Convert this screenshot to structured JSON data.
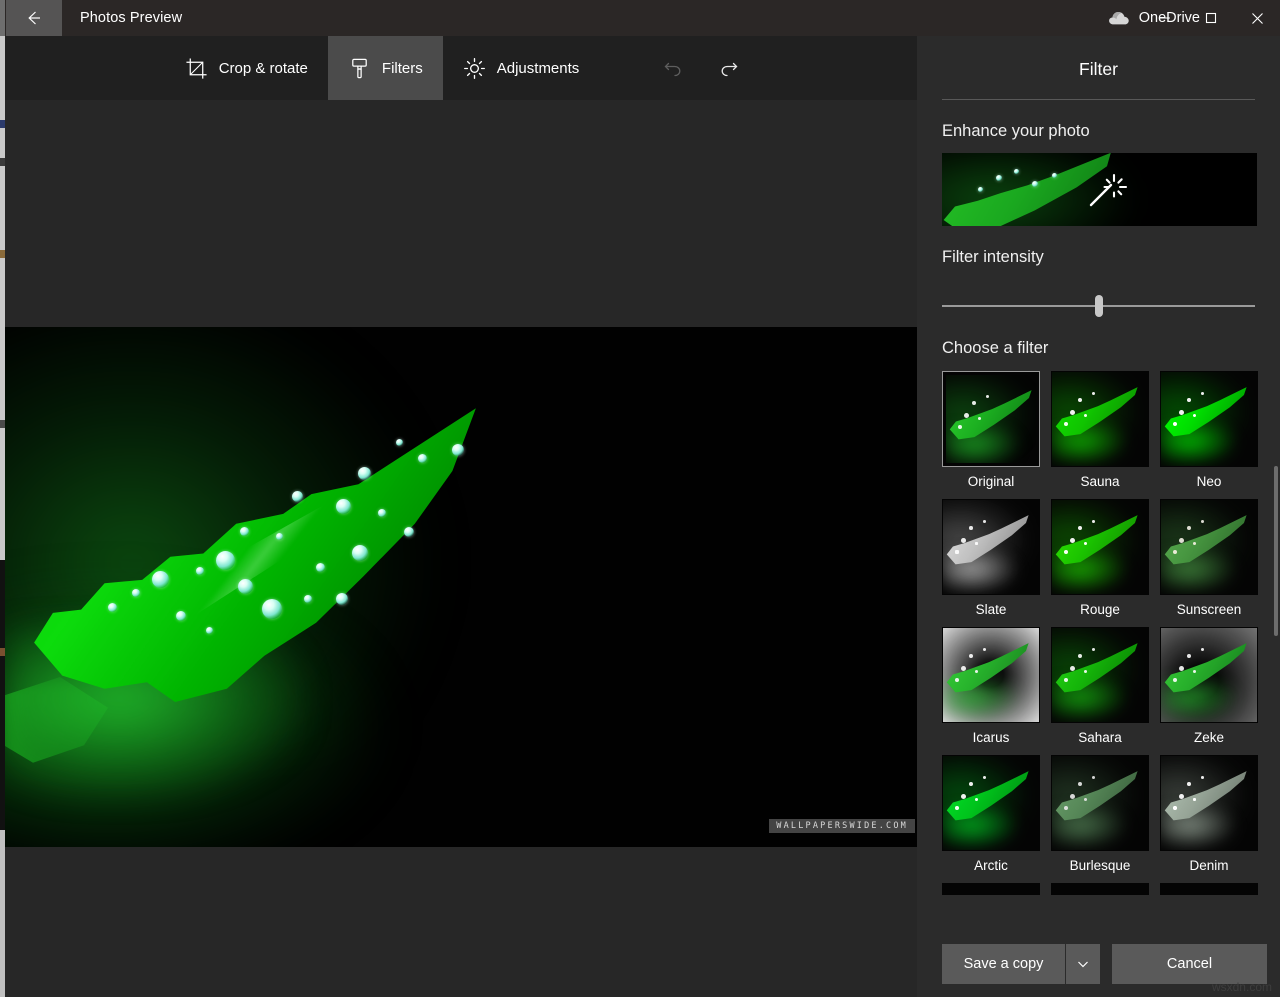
{
  "titlebar": {
    "back_icon": "back-arrow-icon",
    "app_title": "Photos Preview",
    "onedrive_icon": "cloud-icon",
    "onedrive_label": "OneDrive",
    "minimize_label": "Minimize",
    "maximize_label": "Maximize",
    "close_label": "Close"
  },
  "toolbar": {
    "tools": [
      {
        "label": "Crop & rotate",
        "icon": "crop-icon",
        "active": false
      },
      {
        "label": "Filters",
        "icon": "filter-brush-icon",
        "active": true
      },
      {
        "label": "Adjustments",
        "icon": "brightness-sun-icon",
        "active": false
      }
    ],
    "undo": {
      "label": "Undo",
      "icon": "undo-arrow-icon",
      "enabled": false
    },
    "redo": {
      "label": "Redo",
      "icon": "redo-arrow-icon",
      "enabled": true
    }
  },
  "photo": {
    "watermark": "WALLPAPERSWIDE.COM",
    "description": "Green leaf with water droplets on black background"
  },
  "panel": {
    "title": "Filter",
    "enhance": {
      "heading": "Enhance your photo",
      "icon": "magic-wand-icon"
    },
    "intensity": {
      "heading": "Filter intensity",
      "value": 50,
      "min": 0,
      "max": 100
    },
    "chooser": {
      "heading": "Choose a filter",
      "selected": "Original",
      "filters": [
        {
          "name": "Original",
          "look": ""
        },
        {
          "name": "Sauna",
          "look": "look-sauna"
        },
        {
          "name": "Neo",
          "look": "look-neo"
        },
        {
          "name": "Slate",
          "look": "look-slate"
        },
        {
          "name": "Rouge",
          "look": "look-rouge"
        },
        {
          "name": "Sunscreen",
          "look": "look-sunscr"
        },
        {
          "name": "Icarus",
          "look": "look-icarus"
        },
        {
          "name": "Sahara",
          "look": "look-sahara"
        },
        {
          "name": "Zeke",
          "look": "look-zeke"
        },
        {
          "name": "Arctic",
          "look": "look-arctic"
        },
        {
          "name": "Burlesque",
          "look": "look-burl"
        },
        {
          "name": "Denim",
          "look": "look-denim"
        }
      ]
    },
    "buttons": {
      "save_label": "Save a copy",
      "save_dropdown_icon": "chevron-down-icon",
      "cancel_label": "Cancel"
    }
  },
  "overlay": {
    "site_watermark": "wsxdn.com"
  },
  "colors": {
    "titlebar_bg": "#2b2726",
    "toolbar_bg": "#202020",
    "panel_bg": "#2b2b2b",
    "editor_bg": "#272727",
    "button_bg": "#5a5a5a",
    "accent_selected": "#9a9a9a",
    "text": "#ffffff"
  }
}
